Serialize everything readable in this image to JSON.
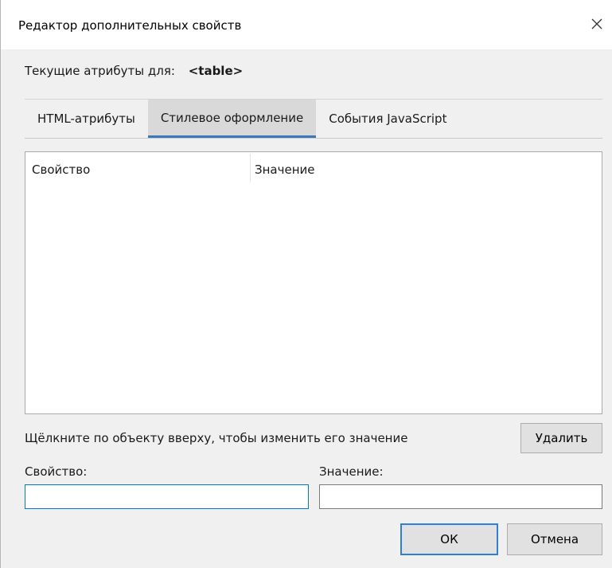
{
  "window": {
    "title": "Редактор дополнительных свойств",
    "close_icon": "close-icon"
  },
  "current": {
    "label": "Текущие атрибуты для:",
    "tag": "<table>"
  },
  "tabs": [
    {
      "label": "HTML-атрибуты",
      "active": false
    },
    {
      "label": "Стилевое оформление",
      "active": true
    },
    {
      "label": "События JavaScript",
      "active": false
    }
  ],
  "grid": {
    "columns": [
      "Свойство",
      "Значение"
    ],
    "rows": []
  },
  "hint": "Щёлкните по объекту вверху, чтобы изменить его значение",
  "buttons": {
    "delete": "Удалить",
    "ok": "ОК",
    "cancel": "Отмена"
  },
  "fields": {
    "property_label": "Свойство:",
    "property_value": "",
    "value_label": "Значение:",
    "value_value": ""
  },
  "colors": {
    "active_tab_underline": "#3b77b9",
    "focus_border": "#0078d7"
  }
}
